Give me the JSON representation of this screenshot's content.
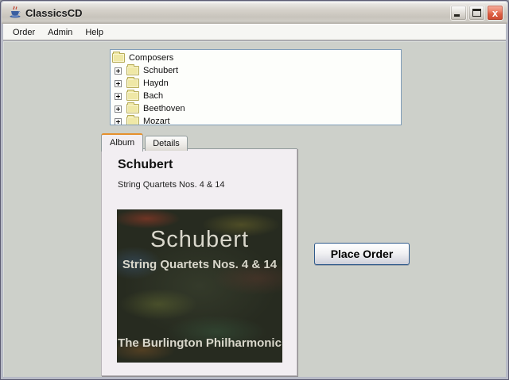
{
  "window": {
    "title": "ClassicsCD",
    "icon": "java-cup"
  },
  "titlebar": {
    "buttons": {
      "minimize": "minimize",
      "maximize": "maximize",
      "close_glyph": "x"
    }
  },
  "menu": {
    "items": [
      "Order",
      "Admin",
      "Help"
    ]
  },
  "tree": {
    "root": "Composers",
    "expand_glyph": "+",
    "children": [
      "Schubert",
      "Haydn",
      "Bach",
      "Beethoven",
      "Mozart"
    ]
  },
  "tabs": {
    "album": "Album",
    "details": "Details",
    "selected": "Album"
  },
  "album_panel": {
    "title": "Schubert",
    "subtitle": "String Quartets Nos. 4 & 14"
  },
  "album_cover": {
    "line1": "Schubert",
    "line2": "String Quartets Nos. 4 & 14",
    "line3": "The Burlington Philharmonic"
  },
  "actions": {
    "place_order": "Place Order"
  },
  "colors": {
    "content_bg": "#CDD0CA",
    "panel_bg": "#F2EEF2",
    "tab_accent_orange": "#E6902C",
    "tree_border_blue": "#7F9DB9",
    "close_button_red": "#DC5E42",
    "button_border_blue": "#2F5A8B",
    "cover_bg_dark": "#272B20",
    "folder_yellow": "#EFE8A6"
  }
}
